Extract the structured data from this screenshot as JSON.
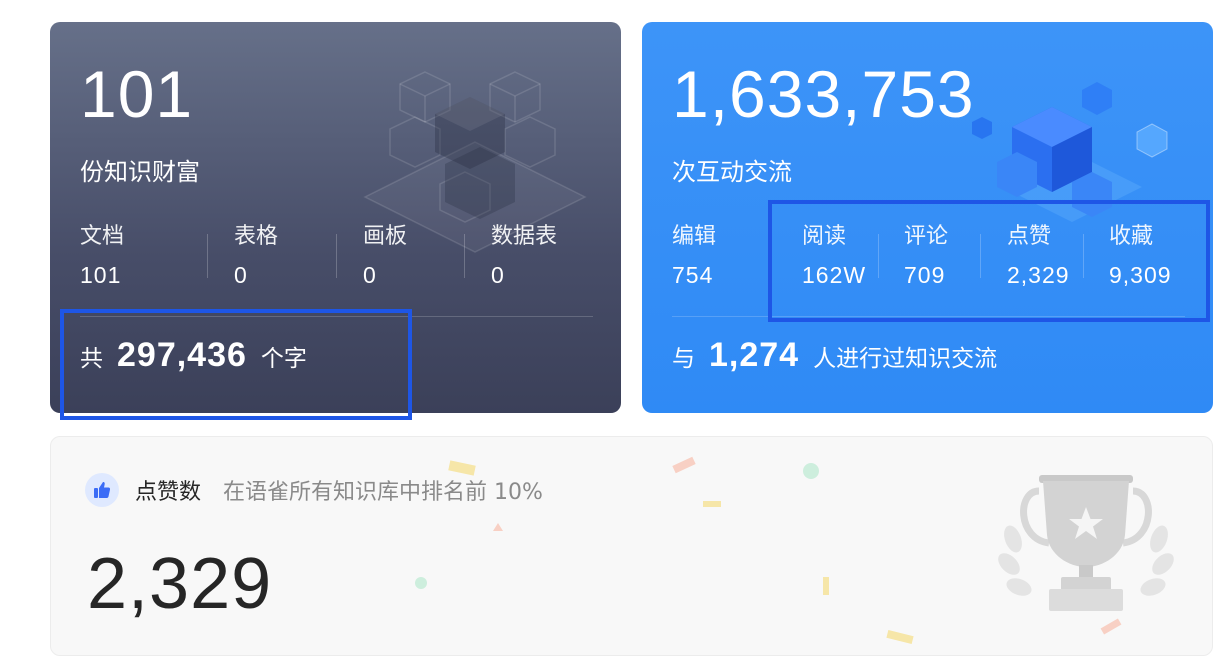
{
  "knowledge": {
    "total": "101",
    "subtitle": "份知识财富",
    "stats": [
      {
        "label": "文档",
        "value": "101"
      },
      {
        "label": "表格",
        "value": "0"
      },
      {
        "label": "画板",
        "value": "0"
      },
      {
        "label": "数据表",
        "value": "0"
      }
    ],
    "words_prefix": "共",
    "words_count": "297,436",
    "words_suffix": "个字",
    "icon": "cubes-illustration"
  },
  "interaction": {
    "total": "1,633,753",
    "subtitle": "次互动交流",
    "stats": [
      {
        "label": "编辑",
        "value": "754"
      },
      {
        "label": "阅读",
        "value": "162W"
      },
      {
        "label": "评论",
        "value": "709"
      },
      {
        "label": "点赞",
        "value": "2,329"
      },
      {
        "label": "收藏",
        "value": "9,309"
      }
    ],
    "people_prefix": "与",
    "people_count": "1,274",
    "people_suffix": "人进行过知识交流",
    "icon": "blue-cubes-illustration"
  },
  "likes": {
    "title": "点赞数",
    "rank_text": "在语雀所有知识库中排名前 10%",
    "count": "2,329",
    "icon": "thumbs-up-icon",
    "trophy_icon": "trophy-icon"
  },
  "colors": {
    "dark_card": "#474d68",
    "blue_card": "#2f8af5",
    "highlight": "#1e56e6"
  }
}
